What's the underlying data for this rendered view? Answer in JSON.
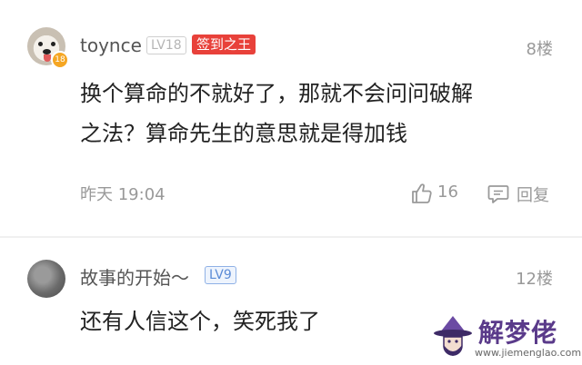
{
  "comments": [
    {
      "username": "toynce",
      "level": "LV18",
      "level_dot": "18",
      "title_badge": "签到之王",
      "floor": "8楼",
      "lines": [
        "换个算命的不就好了，那就不会问问破解",
        "之法？算命先生的意思就是得加钱"
      ],
      "time": "昨天 19:04",
      "likes": "16",
      "reply_label": "回复"
    },
    {
      "username": "故事的开始～",
      "level": "LV9",
      "floor": "12楼",
      "lines": [
        "还有人信这个，笑死我了"
      ]
    }
  ],
  "watermark": {
    "title": "解梦佬",
    "url": "www.jiemenglao.com"
  },
  "colors": {
    "sign_badge": "#e8413a",
    "level_blue": "#5b8bd6",
    "meta_gray": "#999999",
    "watermark_purple": "#5a3a8a"
  }
}
